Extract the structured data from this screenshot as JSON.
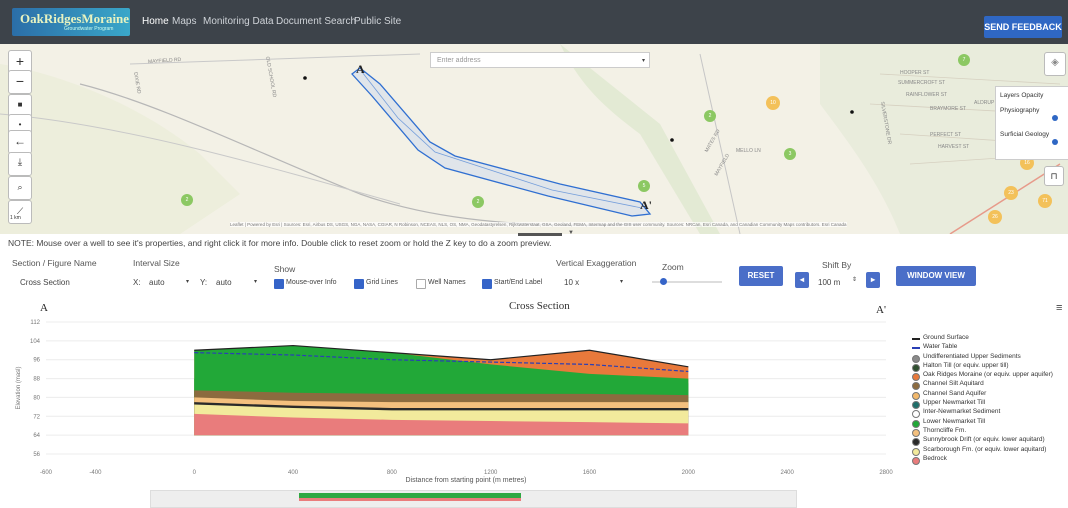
{
  "nav": {
    "logo_text": "OakRidgesMoraine",
    "logo_sub": "Groundwater Program",
    "items": [
      "Home",
      "Maps",
      "Monitoring Data",
      "Document Search",
      "Public Site"
    ],
    "feedback": "SEND FEEDBACK"
  },
  "map": {
    "zoom_in": "+",
    "zoom_out": "−",
    "search_placeholder": "Enter address",
    "scale": "1 km",
    "section_start": "A",
    "section_end": "A'",
    "layers_title": "Layers Opacity",
    "layers": [
      "Physiography",
      "Surficial Geology"
    ],
    "attribution": "Leaflet | Powered by Esri | Sources: Esri, Airbus DS, USGS, NGA, NASA, CGIAR, N Robinson, NCEAS, NLS, OS, NMA, Geodatastyrelsen, Rijkswaterstaat, GSA, Geoland, FEMA, Intermap and the GIS user community. Sources: NRCan, Esri Canada, and Canadian Community Maps contributors. Esri Canada",
    "clusters": [
      "2",
      "7",
      "10",
      "2",
      "5",
      "3",
      "2",
      "16",
      "23",
      "71",
      "26"
    ],
    "roads": [
      "MAYFIELD RD",
      "DIXIE RD",
      "OLD SCHOOL RD",
      "SILVERSTONE DR",
      "SUMMERCROFT ST",
      "RAINFLOWER ST",
      "PERFECT ST",
      "HOOPER ST",
      "HARVEST ST",
      "ALDRUP ST",
      "BRAYMORE ST",
      "MELLO LN",
      "MAYFIELD",
      "MATES RD"
    ]
  },
  "note": "NOTE: Mouse over a well to see it's properties, and right click it for more info. Double click to reset zoom or hold the Z key to do a zoom preview.",
  "controls": {
    "section_label": "Section / Figure Name",
    "section_value": "Cross Section",
    "interval_label": "Interval Size",
    "x_label": "X:",
    "x_value": "auto",
    "y_label": "Y:",
    "y_value": "auto",
    "show_label": "Show",
    "checkboxes": [
      {
        "label": "Mouse-over Info",
        "checked": true
      },
      {
        "label": "Grid Lines",
        "checked": true
      },
      {
        "label": "Well Names",
        "checked": false
      },
      {
        "label": "Start/End Label",
        "checked": true
      }
    ],
    "vex_label": "Vertical Exaggeration",
    "vex_value": "10 x",
    "zoom_label": "Zoom",
    "reset": "RESET",
    "shift_label": "Shift By",
    "shift_value": "100 m",
    "shift_left": "◂",
    "shift_right": "▸",
    "window_view": "WINDOW VIEW"
  },
  "chart_data": {
    "type": "area",
    "title": "Cross Section",
    "start_label": "A",
    "end_label": "A'",
    "xlabel": "Distance from starting point (m metres)",
    "ylabel": "Elevation (masl)",
    "xlim": [
      -600,
      2800
    ],
    "ylim": [
      56,
      112
    ],
    "x_ticks": [
      "-600",
      "-400",
      "0",
      "400",
      "800",
      "1200",
      "1600",
      "2000",
      "2400",
      "2800"
    ],
    "y_ticks": [
      "112",
      "104",
      "96",
      "88",
      "80",
      "72",
      "64",
      "56"
    ],
    "x": [
      0,
      400,
      800,
      1200,
      1600,
      2000
    ],
    "layers": [
      {
        "name": "Bedrock",
        "color": "#e97c7c",
        "top": [
          73,
          71.5,
          70.5,
          70,
          69.5,
          69
        ]
      },
      {
        "name": "Scarborough Fm. (or equiv. lower aquitard)",
        "color": "#f2ea9c",
        "top": [
          77,
          75.5,
          74.5,
          74.5,
          74.5,
          74.5
        ]
      },
      {
        "name": "Sunnybrook Drift (or equiv. lower aquitard)",
        "color": "#2a2a2a",
        "top": [
          78,
          76.5,
          75.5,
          75.5,
          75.5,
          75.5
        ]
      },
      {
        "name": "Thorncliffe Fm.",
        "color": "#f4c07e",
        "top": [
          80,
          78.5,
          78,
          78,
          78,
          78
        ]
      },
      {
        "name": "Channel Silt Aquitard",
        "color": "#8c6b3f",
        "top": [
          83,
          82,
          81.5,
          81.5,
          81.5,
          81
        ]
      },
      {
        "name": "Lower Newmarket Till",
        "color": "#22a838",
        "top": [
          88,
          88,
          87,
          86.5,
          86.5,
          86
        ]
      },
      {
        "name": "Oak Ridges Moraine (or equiv. upper aquifer)",
        "color": "#e8793b",
        "top": [
          100,
          102,
          99,
          96,
          100,
          93
        ]
      }
    ],
    "ground_surface": [
      100,
      102,
      99,
      96,
      100,
      93
    ],
    "water_table": [
      99,
      98,
      96,
      95,
      94,
      91
    ],
    "legend": [
      {
        "name": "Ground Surface",
        "kind": "line",
        "color": "#222222"
      },
      {
        "name": "Water Table",
        "kind": "line",
        "color": "#2a3fb5"
      },
      {
        "name": "Undifferentiated Upper Sediments",
        "kind": "dot",
        "color": "#8a8a8a"
      },
      {
        "name": "Halton Till (or equiv. upper till)",
        "kind": "dot",
        "color": "#2f4f2f"
      },
      {
        "name": "Oak Ridges Moraine (or equiv. upper aquifer)",
        "kind": "dot",
        "color": "#e8793b"
      },
      {
        "name": "Channel Silt Aquitard",
        "kind": "dot",
        "color": "#8c6b3f"
      },
      {
        "name": "Channel Sand Aquifer",
        "kind": "dot",
        "color": "#f2b86b"
      },
      {
        "name": "Upper Newmarket Till",
        "kind": "dot",
        "color": "#1f6f6a"
      },
      {
        "name": "Inter-Newmarket Sediment",
        "kind": "dot",
        "color": "#ffffff"
      },
      {
        "name": "Lower Newmarket Till",
        "kind": "dot",
        "color": "#22a838"
      },
      {
        "name": "Thorncliffe Fm.",
        "kind": "dot",
        "color": "#f4c07e"
      },
      {
        "name": "Sunnybrook Drift (or equiv. lower aquitard)",
        "kind": "dot",
        "color": "#2a2a2a"
      },
      {
        "name": "Scarborough Fm. (or equiv. lower aquitard)",
        "kind": "dot",
        "color": "#f2ea9c"
      },
      {
        "name": "Bedrock",
        "kind": "dot",
        "color": "#e97c7c"
      }
    ]
  }
}
